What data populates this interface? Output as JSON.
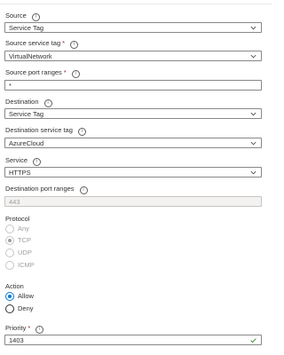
{
  "info_glyph": "i",
  "fields": {
    "source": {
      "label": "Source",
      "value": "Service Tag",
      "required": false
    },
    "source_service_tag": {
      "label": "Source service tag",
      "value": "VirtualNetwork",
      "required": true
    },
    "source_port_ranges": {
      "label": "Source port ranges",
      "value": "*",
      "required": true
    },
    "destination": {
      "label": "Destination",
      "value": "Service Tag",
      "required": false
    },
    "destination_service_tag": {
      "label": "Destination service tag",
      "value": "AzureCloud",
      "required": false
    },
    "service": {
      "label": "Service",
      "value": "HTTPS",
      "required": false
    },
    "destination_port_ranges": {
      "label": "Destination port ranges",
      "value": "443",
      "required": false,
      "disabled": true
    },
    "priority": {
      "label": "Priority",
      "value": "1403",
      "required": true,
      "valid": true
    }
  },
  "required_marker": "*",
  "protocol": {
    "label": "Protocol",
    "disabled": true,
    "options": [
      "Any",
      "TCP",
      "UDP",
      "ICMP"
    ],
    "selected": "TCP"
  },
  "action": {
    "label": "Action",
    "options": [
      "Allow",
      "Deny"
    ],
    "selected": "Allow"
  },
  "colors": {
    "accent": "#0078d4",
    "required": "#a4262c",
    "valid_check": "#107c10",
    "border": "#8a8886",
    "disabled_bg": "#f3f2f1"
  }
}
